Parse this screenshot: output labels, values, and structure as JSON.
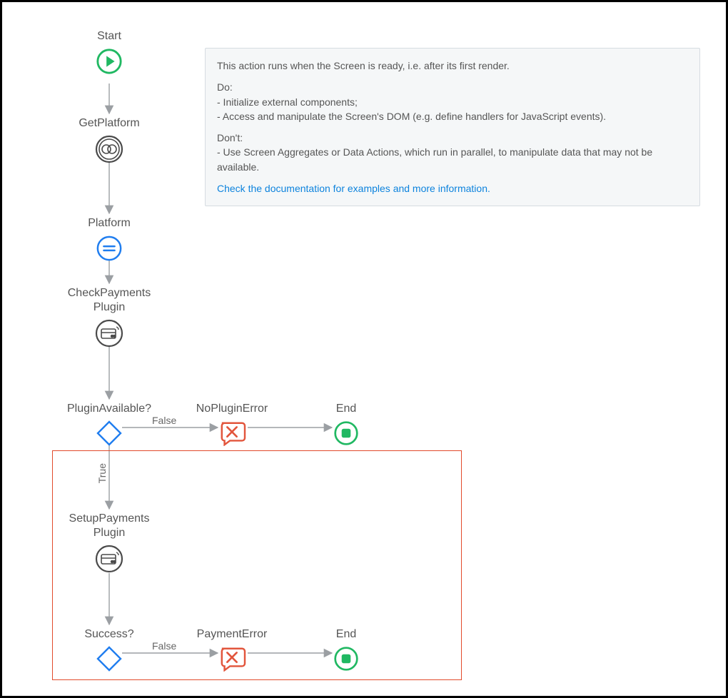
{
  "info": {
    "intro": "This action runs when the Screen is ready, i.e. after its first render.",
    "do_header": "Do:",
    "do_item1": "- Initialize external components;",
    "do_item2": "- Access and manipulate the Screen's DOM (e.g. define handlers for JavaScript events).",
    "dont_header": "Don't:",
    "dont_item1": "- Use Screen Aggregates or Data Actions, which run in parallel, to manipulate data that may not be available.",
    "link": "Check the documentation for examples and more information."
  },
  "nodes": {
    "start": "Start",
    "getPlatform": "GetPlatform",
    "platform": "Platform",
    "checkPayments": "CheckPayments\nPlugin",
    "pluginAvailable": "PluginAvailable?",
    "noPluginError": "NoPluginError",
    "end1": "End",
    "setupPayments": "SetupPayments\nPlugin",
    "success": "Success?",
    "paymentError": "PaymentError",
    "end2": "End"
  },
  "edges": {
    "false1": "False",
    "true": "True",
    "false2": "False"
  }
}
